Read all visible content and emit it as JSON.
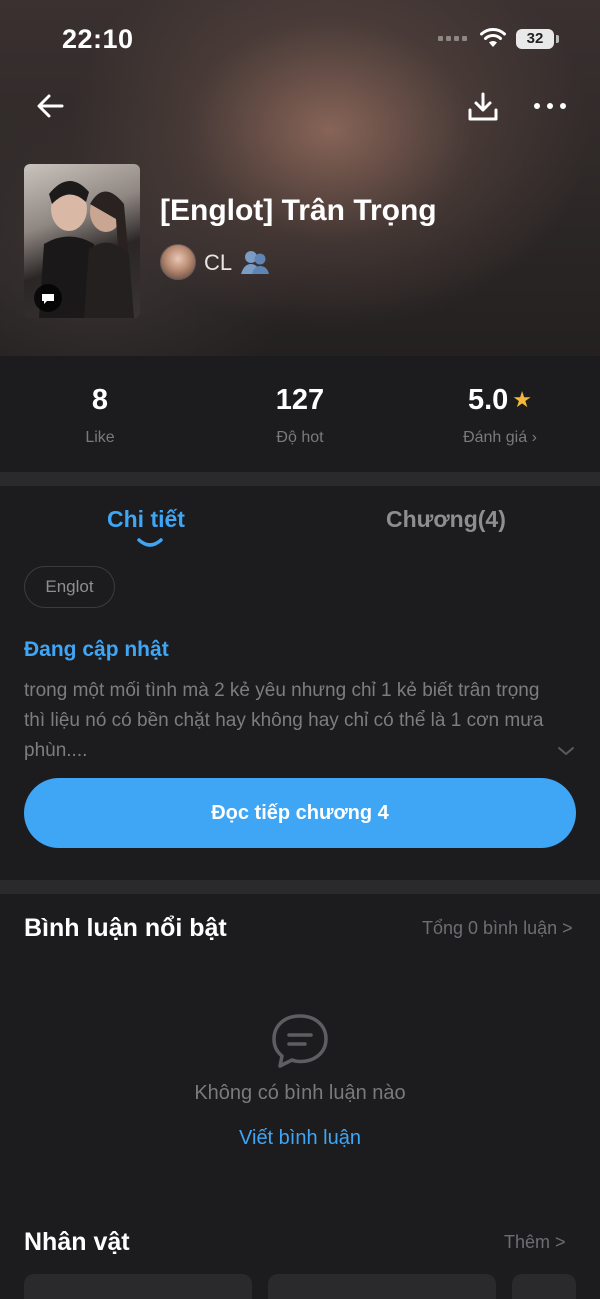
{
  "status_bar": {
    "time": "22:10",
    "battery": "32"
  },
  "story": {
    "title": "[Englot] Trân Trọng",
    "author": "CL"
  },
  "stats": [
    {
      "value": "8",
      "label": "Like"
    },
    {
      "value": "127",
      "label": "Độ hot"
    },
    {
      "value": "5.0",
      "label": "Đánh giá ›"
    }
  ],
  "tabs": [
    {
      "label": "Chi tiết",
      "active": true
    },
    {
      "label": "Chương(4)",
      "active": false
    }
  ],
  "tags": [
    "Englot"
  ],
  "detail": {
    "status": "Đang cập nhật",
    "description": "trong một mối tình mà 2 kẻ yêu nhưng chỉ 1 kẻ biết trân trọng thì liệu nó có bền chặt hay không hay chỉ có thể là 1 cơn mưa phùn...."
  },
  "cta": {
    "label": "Đọc tiếp chương 4"
  },
  "comments": {
    "title": "Bình luận nổi bật",
    "total": "Tổng 0 bình luận >",
    "empty": "Không có bình luận nào",
    "write": "Viết bình luận"
  },
  "characters": {
    "title": "Nhân vật",
    "more": "Thêm >"
  },
  "colors": {
    "accent": "#3ea6f5",
    "star": "#f3b73a",
    "background": "#1c1c1e"
  },
  "icons": [
    "back-arrow-icon",
    "download-icon",
    "more-icon",
    "star-icon",
    "comment-icon",
    "chevron-down-icon"
  ]
}
